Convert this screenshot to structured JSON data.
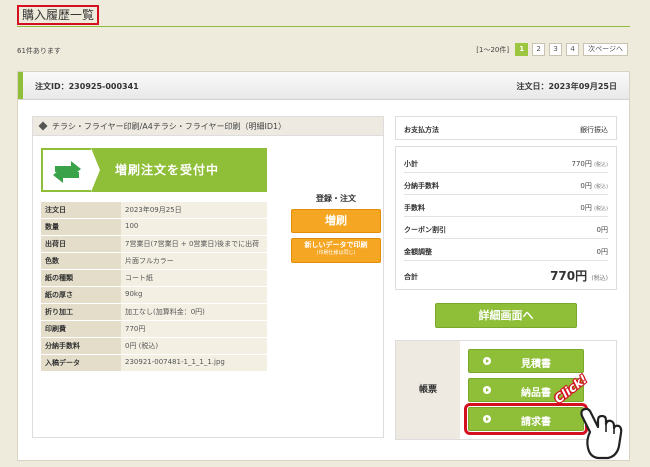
{
  "page": {
    "title": "購入履歴一覧"
  },
  "summary": {
    "count_text": "61件あります"
  },
  "pager": {
    "range": "[1～20件]",
    "pages": [
      "1",
      "2",
      "3",
      "4"
    ],
    "next": "次ページへ"
  },
  "order": {
    "id_text": "注文ID：230925-000341",
    "date_text": "注文日：2023年09月25日"
  },
  "item": {
    "header": "チラシ・フライヤー印刷/A4チラシ・フライヤー印刷（明細ID1）"
  },
  "banner": {
    "label": "増刷注文を受付中"
  },
  "specs": [
    {
      "label": "注文日",
      "value": "2023年09月25日"
    },
    {
      "label": "数量",
      "value": "100"
    },
    {
      "label": "出荷日",
      "value": "7営業日(7営業日 + 0営業日)後までに出荷"
    },
    {
      "label": "色数",
      "value": "片面フルカラー"
    },
    {
      "label": "紙の種類",
      "value": "コート紙"
    },
    {
      "label": "紙の厚さ",
      "value": "90kg"
    },
    {
      "label": "折り加工",
      "value": "加工なし(加算料金：0円)"
    },
    {
      "label": "印刷費",
      "value": "770円"
    },
    {
      "label": "分納手数料",
      "value": "0円 (税込)"
    },
    {
      "label": "入稿データ",
      "value": "230921-007481-1_1_1_1.jpg"
    }
  ],
  "actions": {
    "title": "登録・注文",
    "reprint": "増刷",
    "new_data_main": "新しいデータで印刷",
    "new_data_sub": "(印刷仕様は同じ)"
  },
  "payment": {
    "label": "お支払方法",
    "value": "銀行振込"
  },
  "totals": {
    "subtotal_label": "小計",
    "subtotal_value": "770円",
    "subtotal_tax": "(税込)",
    "split_fee_label": "分納手数料",
    "split_fee_value": "0円",
    "split_fee_tax": "(税込)",
    "fee_label": "手数料",
    "fee_value": "0円",
    "fee_tax": "(税込)",
    "coupon_label": "クーポン割引",
    "coupon_value": "0円",
    "adjust_label": "金額調整",
    "adjust_value": "0円",
    "total_label": "合計",
    "total_value": "770円",
    "total_tax": "(税込)"
  },
  "detail_button": "詳細画面へ",
  "documents": {
    "label": "帳票",
    "estimate": "見積書",
    "delivery": "納品書",
    "invoice": "請求書"
  },
  "overlay": {
    "click_text": "Click!"
  },
  "colors": {
    "accent_green": "#8fbe38",
    "accent_orange": "#f5a623",
    "highlight_red": "#d40f1f",
    "background": "#efebdc"
  }
}
